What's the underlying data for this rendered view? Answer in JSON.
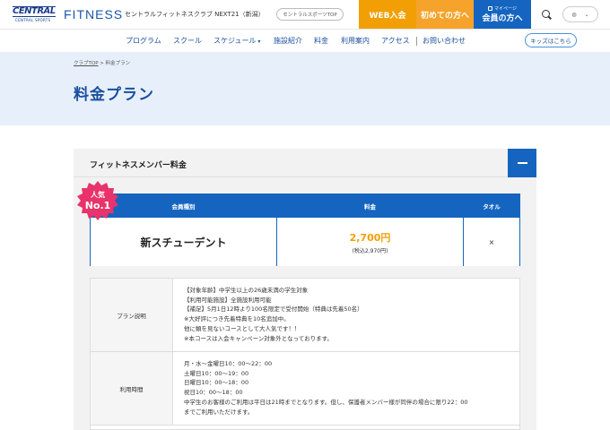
{
  "header": {
    "logo_main": "CENTRAL",
    "logo_sub": "CENTRAL SPORTS",
    "brand": "FITNESS",
    "club_name": "セントラルフィットネスクラブ NEXT21（新潟）",
    "top_link": "セントラルスポーツTOP",
    "web_join": "WEB入会",
    "first_time": "初めての方へ",
    "mypage": "マイページ",
    "member": "会員の方へ",
    "lang_icon": "◍",
    "lang_chevron": "⌄"
  },
  "nav": {
    "items": [
      "プログラム",
      "スクール",
      "スケジュール",
      "施設紹介",
      "料金",
      "利用案内",
      "アクセス",
      "お問い合わせ"
    ],
    "kids": "キッズはこちら"
  },
  "hero": {
    "breadcrumb_home": "クラブTOP",
    "breadcrumb_sep": ">",
    "breadcrumb_current": "料金プラン",
    "title": "料金プラン"
  },
  "section": {
    "title": "フィットネスメンバー料金",
    "badge_line1": "人気",
    "badge_line2": "No.1",
    "table": {
      "headers": [
        "会員種別",
        "料金",
        "タオル"
      ],
      "plan": "新スチューデント",
      "price": "2,700円",
      "price_tax": "(税込2,970円)",
      "towel": "×"
    },
    "details": [
      {
        "label": "プラン説明",
        "lines": [
          "【対象年齢】中学生以上の26歳未満の学生対象",
          "【利用可能施設】全施設利用可能",
          "【補足】5月1日12時より100名限定で受付開始（特典は先着50名）",
          "※大好評につき先着特典を10名追加中。",
          "他に類を見ないコースとして大人気です！！",
          "※本コースは入会キャンペーン対象外となっております。"
        ]
      },
      {
        "label": "利用時間",
        "lines": [
          "月・水〜金曜日10：00〜22：00",
          "土曜日10：00〜19：00",
          "日曜日10：00〜18：00",
          "祝日10：00〜18：00",
          "中学生のお客様のご利用は平日は21時までとなります。但し、保護者メンバー様が同伴の場合に限り22：00",
          "までご利用いただけます。"
        ]
      }
    ]
  },
  "colors": {
    "primary": "#1565c0",
    "orange": "#f29f05",
    "badge_pink": "#e8336b",
    "hero_bg": "#e7f0fa"
  }
}
